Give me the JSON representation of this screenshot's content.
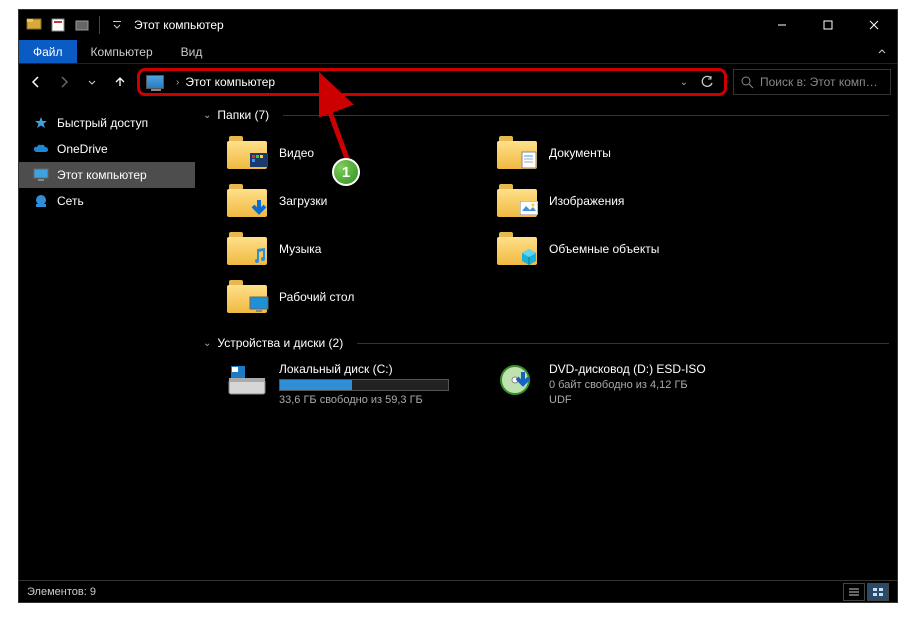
{
  "window": {
    "title": "Этот компьютер"
  },
  "ribbon": {
    "file": "Файл",
    "tabs": [
      "Компьютер",
      "Вид"
    ]
  },
  "address": {
    "location": "Этот компьютер"
  },
  "search": {
    "placeholder": "Поиск в: Этот комп…"
  },
  "sidebar": {
    "items": [
      {
        "label": "Быстрый доступ"
      },
      {
        "label": "OneDrive"
      },
      {
        "label": "Этот компьютер"
      },
      {
        "label": "Сеть"
      }
    ]
  },
  "groups": {
    "folders": {
      "header": "Папки (7)"
    },
    "drives": {
      "header": "Устройства и диски (2)"
    }
  },
  "folders": [
    {
      "label": "Видео"
    },
    {
      "label": "Документы"
    },
    {
      "label": "Загрузки"
    },
    {
      "label": "Изображения"
    },
    {
      "label": "Музыка"
    },
    {
      "label": "Объемные объекты"
    },
    {
      "label": "Рабочий стол"
    }
  ],
  "drives": [
    {
      "name": "Локальный диск (C:)",
      "sub": "33,6 ГБ свободно из 59,3 ГБ",
      "fill_pct": 43
    },
    {
      "name": "DVD-дисковод (D:) ESD-ISO",
      "sub": "0 байт свободно из 4,12 ГБ",
      "sub2": "UDF"
    }
  ],
  "status": {
    "count_label": "Элементов: 9"
  },
  "annotation": {
    "badge": "1"
  }
}
